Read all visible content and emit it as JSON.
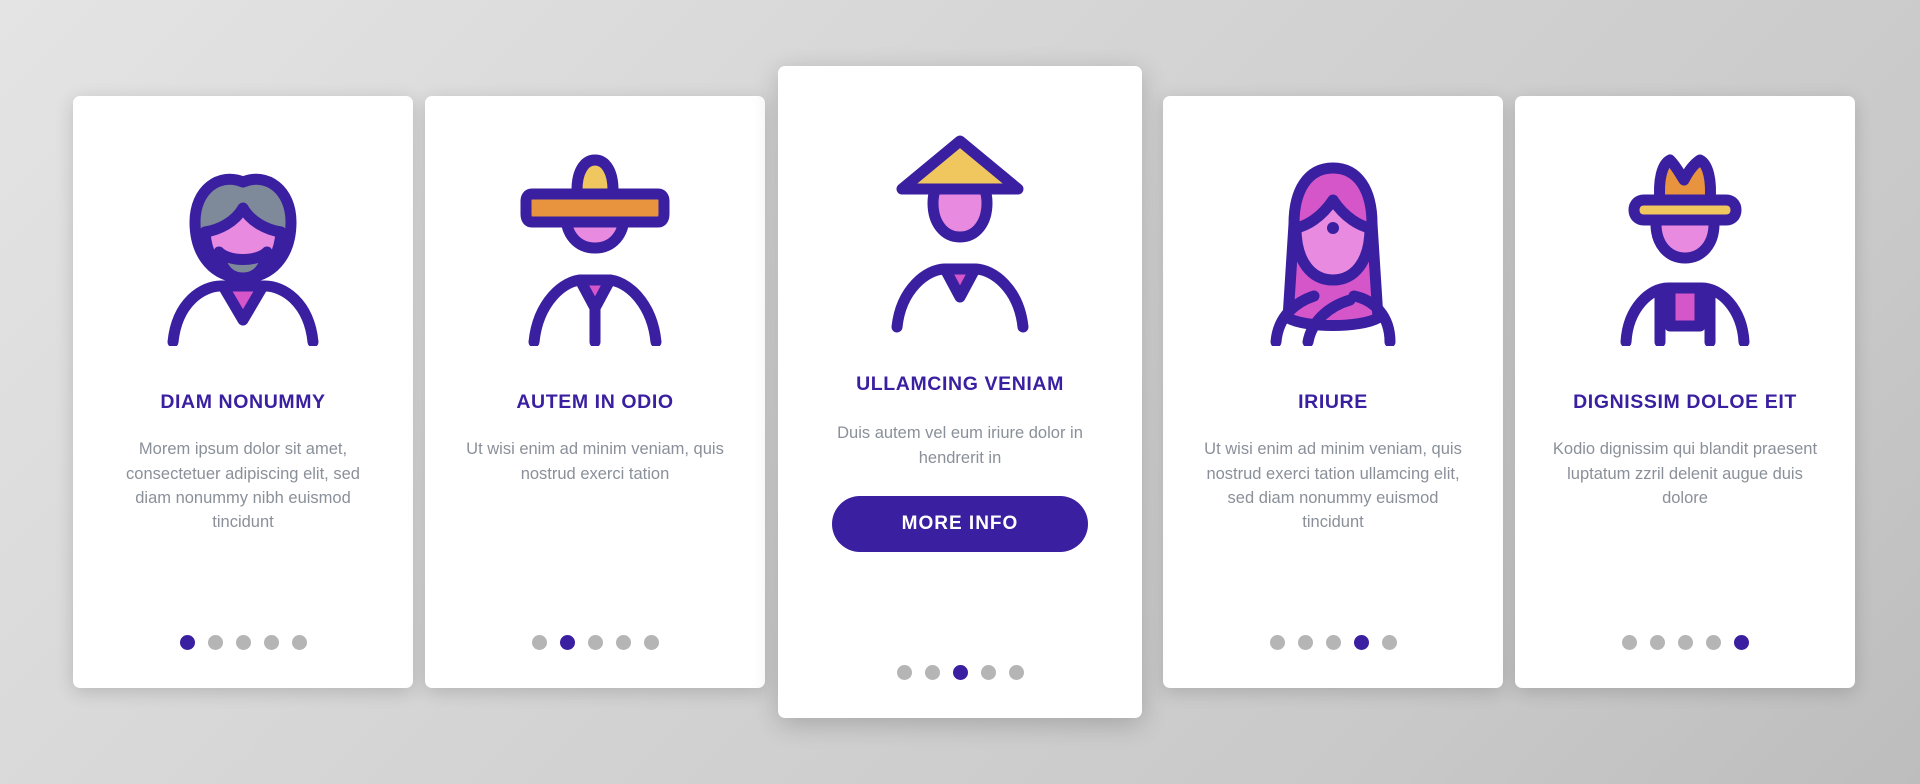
{
  "palette": {
    "background_light": "#e4e4e4",
    "background_dark": "#bdbdbd",
    "card_background": "#ffffff",
    "accent_purple": "#3A1FA0",
    "body_text_gray": "#8a9099",
    "icon_stroke": "#3A1FA0",
    "icon_pink": "#E88AE0",
    "icon_magenta": "#D456C8",
    "icon_gray": "#7E8A99",
    "icon_yellow": "#EFC75E",
    "icon_orange": "#E8933E",
    "dot_inactive": "#b5b5b5"
  },
  "cards": [
    {
      "id": "card-1",
      "icon_name": "bearded-man-avatar-icon",
      "title": "DIAM NONUMMY",
      "body": "Morem ipsum dolor sit amet, consectetuer adipiscing elit, sed diam nonummy nibh euismod tincidunt",
      "cta": null,
      "dots": {
        "count": 5,
        "active_index": 0
      }
    },
    {
      "id": "card-2",
      "icon_name": "sombrero-man-avatar-icon",
      "title": "AUTEM IN ODIO",
      "body": "Ut wisi enim ad minim veniam, quis nostrud exerci tation",
      "cta": null,
      "dots": {
        "count": 5,
        "active_index": 1
      }
    },
    {
      "id": "card-3",
      "icon_name": "conical-hat-man-avatar-icon",
      "title": "ULLAMCING VENIAM",
      "body": "Duis autem vel eum iriure dolor in hendrerit in",
      "cta": "MORE INFO",
      "dots": {
        "count": 5,
        "active_index": 2
      }
    },
    {
      "id": "card-4",
      "icon_name": "long-hair-woman-avatar-icon",
      "title": "IRIURE",
      "body": "Ut wisi enim ad minim veniam, quis nostrud exerci tation ullamcing elit, sed diam nonummy euismod tincidunt",
      "cta": null,
      "dots": {
        "count": 5,
        "active_index": 3
      }
    },
    {
      "id": "card-5",
      "icon_name": "cowboy-hat-man-avatar-icon",
      "title": "DIGNISSIM DOLOE EIT",
      "body": "Kodio dignissim qui blandit praesent luptatum zzril delenit augue duis dolore",
      "cta": null,
      "dots": {
        "count": 5,
        "active_index": 4
      }
    }
  ]
}
